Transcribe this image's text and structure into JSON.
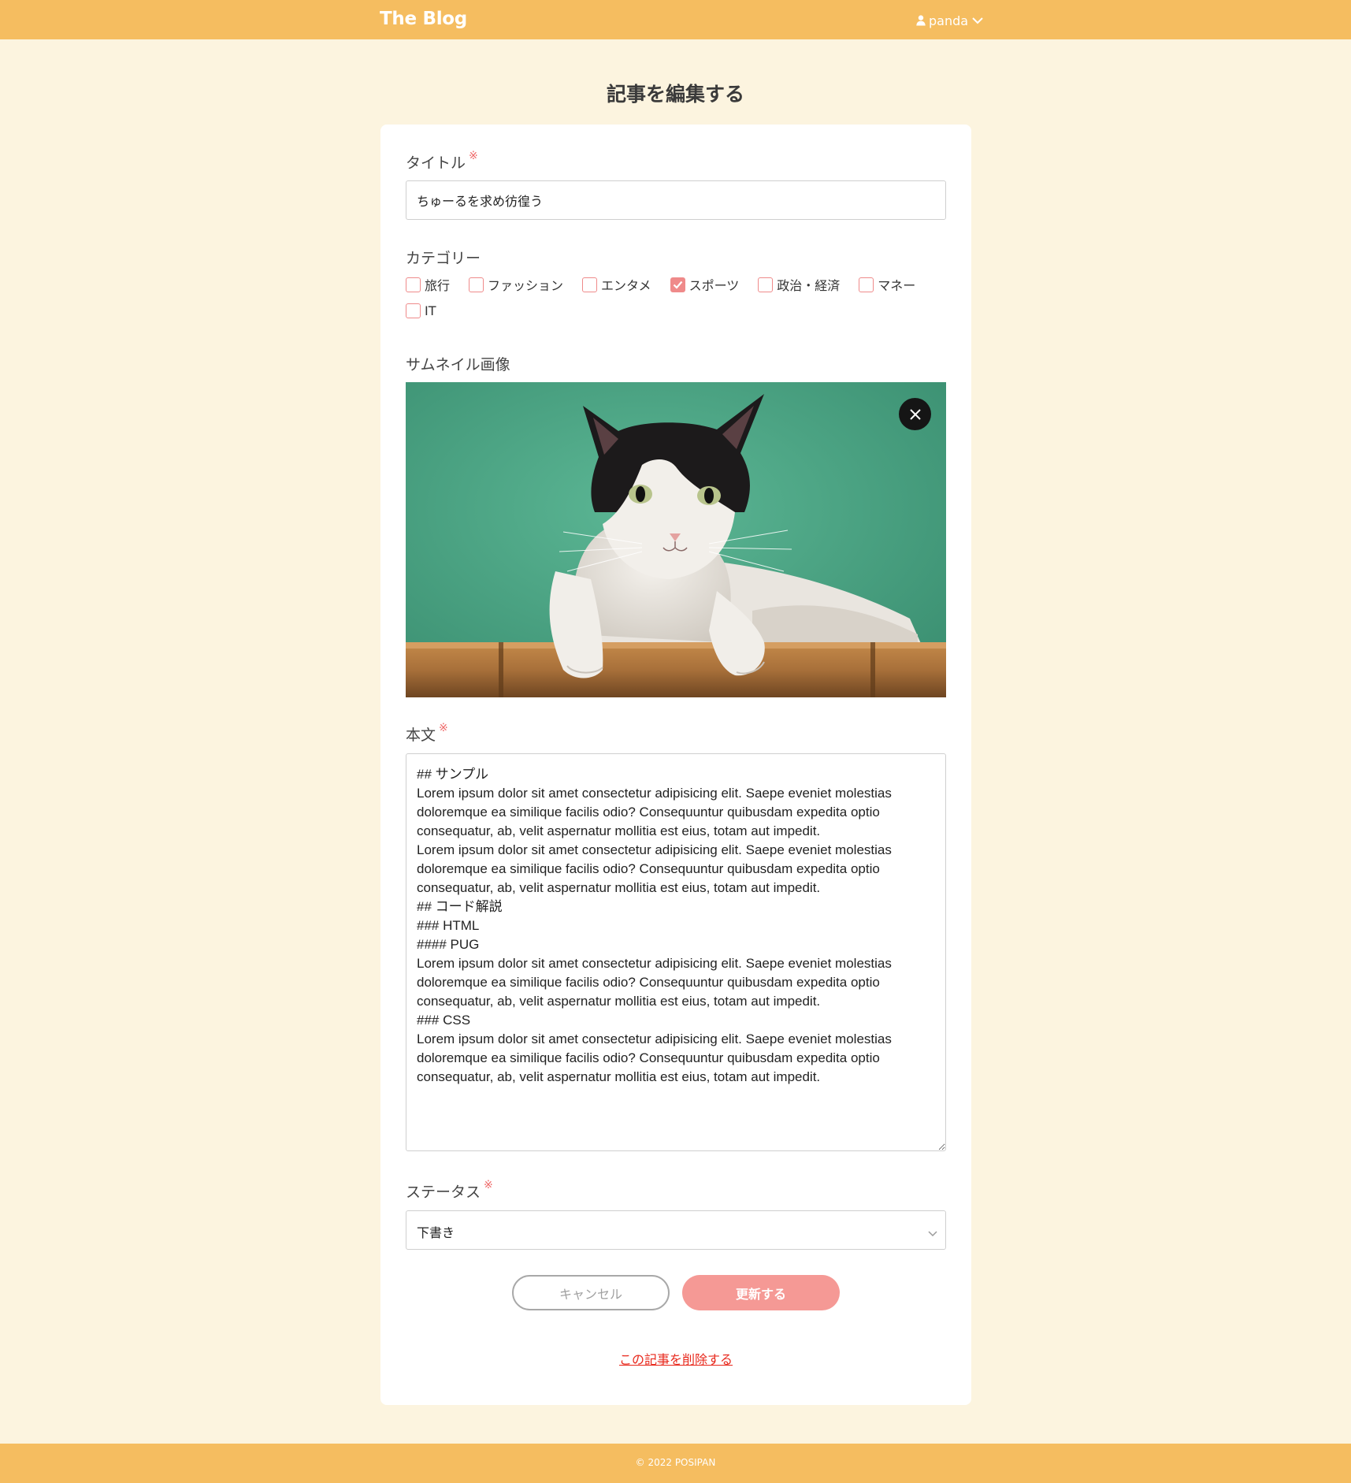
{
  "header": {
    "brand": "The Blog",
    "user_name": "panda"
  },
  "page": {
    "title": "記事を編集する"
  },
  "form": {
    "title_field": {
      "label": "タイトル",
      "required_mark": "※",
      "value": "ちゅーるを求め彷徨う"
    },
    "category_field": {
      "label": "カテゴリー",
      "options": [
        {
          "label": "旅行",
          "checked": false
        },
        {
          "label": "ファッション",
          "checked": false
        },
        {
          "label": "エンタメ",
          "checked": false
        },
        {
          "label": "スポーツ",
          "checked": true
        },
        {
          "label": "政治・経済",
          "checked": false
        },
        {
          "label": "マネー",
          "checked": false
        },
        {
          "label": "IT",
          "checked": false
        }
      ]
    },
    "thumbnail_field": {
      "label": "サムネイル画像"
    },
    "body_field": {
      "label": "本文",
      "required_mark": "※",
      "value": "## サンプル\nLorem ipsum dolor sit amet consectetur adipisicing elit. Saepe eveniet molestias doloremque ea similique facilis odio? Consequuntur quibusdam expedita optio consequatur, ab, velit aspernatur mollitia est eius, totam aut impedit.\nLorem ipsum dolor sit amet consectetur adipisicing elit. Saepe eveniet molestias doloremque ea similique facilis odio? Consequuntur quibusdam expedita optio consequatur, ab, velit aspernatur mollitia est eius, totam aut impedit.\n## コード解説\n### HTML\n#### PUG\nLorem ipsum dolor sit amet consectetur adipisicing elit. Saepe eveniet molestias doloremque ea similique facilis odio? Consequuntur quibusdam expedita optio consequatur, ab, velit aspernatur mollitia est eius, totam aut impedit.\n### CSS\nLorem ipsum dolor sit amet consectetur adipisicing elit. Saepe eveniet molestias doloremque ea similique facilis odio? Consequuntur quibusdam expedita optio consequatur, ab, velit aspernatur mollitia est eius, totam aut impedit."
    },
    "status_field": {
      "label": "ステータス",
      "required_mark": "※",
      "selected": "下書き"
    },
    "cancel_label": "キャンセル",
    "submit_label": "更新する",
    "delete_label": "この記事を削除する"
  },
  "footer": {
    "copyright": "© 2022 POSIPAN"
  },
  "colors": {
    "header_bg": "#f5bd60",
    "page_bg": "#fcf4df",
    "accent": "#f59995",
    "required": "#ef6a6a",
    "danger_link": "#e8291d"
  },
  "icons": {
    "user": "user-icon",
    "chevron": "chevron-down-icon",
    "remove": "close-icon",
    "check": "check-icon"
  }
}
